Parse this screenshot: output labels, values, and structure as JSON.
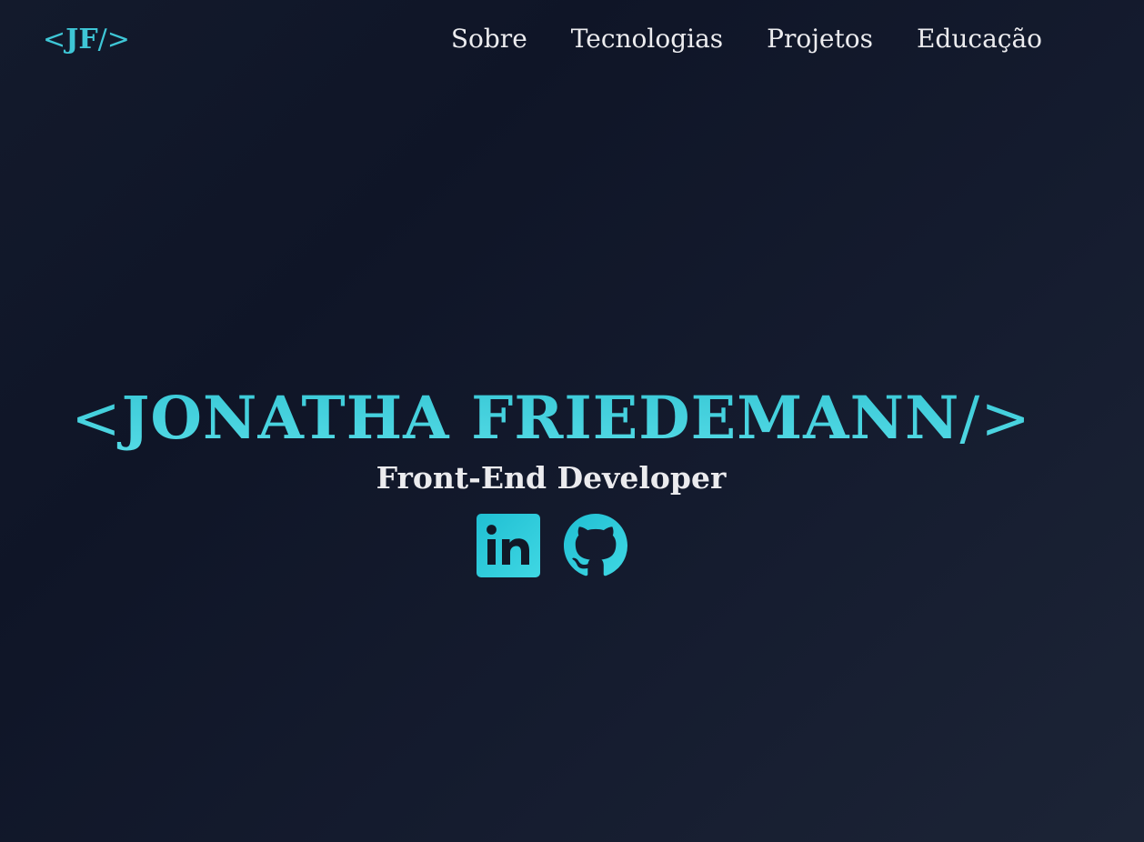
{
  "nav": {
    "logo": {
      "open": "<",
      "initials": "JF",
      "close": "/>"
    },
    "links": [
      {
        "label": "Sobre"
      },
      {
        "label": "Tecnologias"
      },
      {
        "label": "Projetos"
      },
      {
        "label": "Educação"
      }
    ]
  },
  "hero": {
    "name_open": "<",
    "name": "JONATHA FRIEDEMANN",
    "name_close": "/>",
    "subtitle": "Front-End Developer",
    "socials": [
      {
        "icon": "linkedin-icon"
      },
      {
        "icon": "github-icon"
      }
    ]
  },
  "colors": {
    "accent": "#3ec6d6",
    "background": "#111827",
    "text": "#ececef"
  }
}
